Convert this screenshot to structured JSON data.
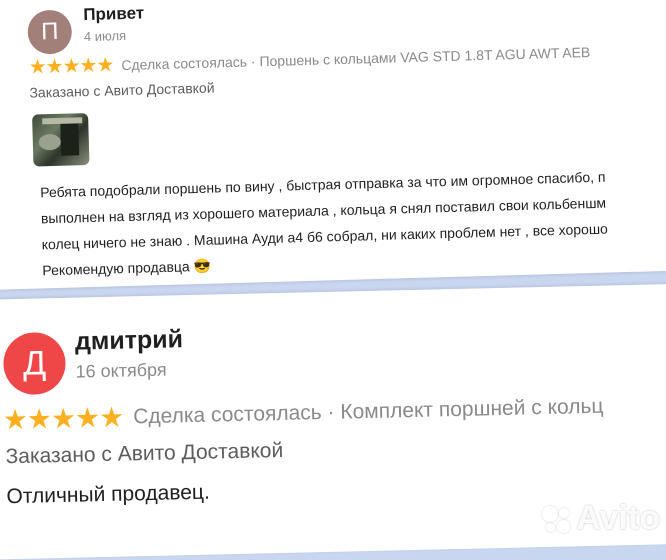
{
  "reviews": [
    {
      "avatar_letter": "П",
      "avatar_color": "#a27f78",
      "author": "Привет",
      "date": "4 июля",
      "stars": "★★★★★",
      "deal": "Сделка состоялась · Поршень с кольцами VAG STD 1.8T AGU AWT AEB",
      "ordered": "Заказано с Авито Доставкой",
      "comment_lines": [
        "Ребята подобрали поршень по вину , быстрая отправка за что им огромное спасибо, п",
        "выполнен на взгляд из хорошего материала , кольца я снял поставил свои кольбеншм",
        "колец ничего не знаю . Машина Ауди а4 б6 собрал, ни каких проблем нет , все хорошо",
        "Рекомендую продавца 😎"
      ]
    },
    {
      "avatar_letter": "Д",
      "avatar_color": "#ef4747",
      "author": "дмитрий",
      "date": "16 октября",
      "stars": "★★★★★",
      "deal": "Сделка состоялась · Комплект поршней с кольц",
      "ordered": "Заказано с Авито Доставкой",
      "comment_lines": [
        "Отличный продавец."
      ]
    }
  ],
  "watermark": "Avito",
  "colors": {
    "background": "#c9d6f0",
    "star": "#ffb020"
  },
  "icons": {
    "photo": "engine-photo-thumbnail",
    "logo": "avito-logo-icon"
  }
}
